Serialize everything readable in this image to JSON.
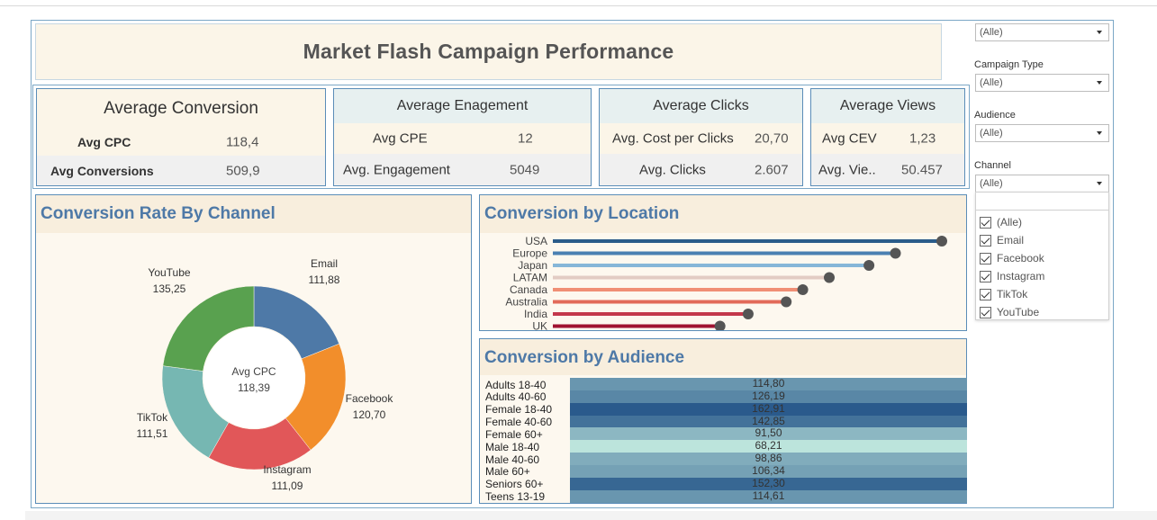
{
  "title": "Market Flash Campaign Performance",
  "kpis": {
    "conversion": {
      "title": "Average Conversion",
      "rows": [
        {
          "label": "Avg CPC",
          "value": "118,4"
        },
        {
          "label": "Avg Conversions",
          "value": "509,9"
        }
      ]
    },
    "engagement": {
      "title": "Average Enagement",
      "rows": [
        {
          "label": "Avg CPE",
          "value": "12"
        },
        {
          "label": "Avg. Engagement",
          "value": "5049"
        }
      ]
    },
    "clicks": {
      "title": "Average Clicks",
      "rows": [
        {
          "label": "Avg. Cost per Clicks",
          "value": "20,70"
        },
        {
          "label": "Avg. Clicks",
          "value": "2.607"
        }
      ]
    },
    "views": {
      "title": "Average Views",
      "rows": [
        {
          "label": "Avg CEV",
          "value": "1,23"
        },
        {
          "label": "Avg. Vie..",
          "value": "50.457"
        }
      ]
    }
  },
  "panels": {
    "channel": {
      "title": "Conversion Rate By Channel",
      "center_label": "Avg CPC",
      "center_value": "118,39"
    },
    "location": {
      "title": "Conversion by Location"
    },
    "audience": {
      "title": "Conversion by Audience"
    }
  },
  "filters": {
    "top": {
      "value": "(Alle)"
    },
    "campaign_type": {
      "label": "Campaign Type",
      "value": "(Alle)"
    },
    "audience": {
      "label": "Audience",
      "value": "(Alle)"
    },
    "channel": {
      "label": "Channel",
      "value": "(Alle)"
    },
    "channel_options": [
      "(Alle)",
      "Email",
      "Facebook",
      "Instagram",
      "TikTok",
      "YouTube"
    ]
  },
  "colors": {
    "accent": "#4e79a7",
    "panel_bg": "#fdf8ef",
    "header_bg": "#f8eedd"
  },
  "chart_data": [
    {
      "type": "pie",
      "variant": "donut",
      "title": "Conversion Rate By Channel",
      "categories": [
        "Email",
        "Facebook",
        "Instagram",
        "TikTok",
        "YouTube"
      ],
      "values": [
        111.88,
        120.7,
        111.09,
        111.51,
        135.25
      ],
      "value_labels": [
        "111,88",
        "120,70",
        "111,09",
        "111,51",
        "135,25"
      ],
      "colors": [
        "#4e79a7",
        "#f28e2b",
        "#e15759",
        "#76b7b2",
        "#59a14f"
      ]
    },
    {
      "type": "bar",
      "variant": "lollipop",
      "title": "Conversion by Location",
      "categories": [
        "USA",
        "Europe",
        "Japan",
        "LATAM",
        "Canada",
        "Australia",
        "India",
        "UK"
      ],
      "values": [
        235,
        207,
        191,
        167,
        151,
        141,
        118,
        101
      ],
      "colors": [
        "#2b5c8a",
        "#4a80b2",
        "#86b6d8",
        "#e2ccc4",
        "#f08f75",
        "#e26a59",
        "#c3384b",
        "#a01230"
      ]
    },
    {
      "type": "heatmap",
      "title": "Conversion by Audience",
      "categories": [
        "Adults 18-40",
        "Adults 40-60",
        "Female 18-40",
        "Female 40-60",
        "Female 60+",
        "Male 18-40",
        "Male 40-60",
        "Male 60+",
        "Seniors 60+",
        "Teens 13-19"
      ],
      "values": [
        114.8,
        126.19,
        162.91,
        142.85,
        91.5,
        68.21,
        98.86,
        106.34,
        152.3,
        114.61
      ],
      "value_labels": [
        "114,80",
        "126,19",
        "162,91",
        "142,85",
        "91,50",
        "68,21",
        "98,86",
        "106,34",
        "152,30",
        "114,61"
      ]
    }
  ]
}
